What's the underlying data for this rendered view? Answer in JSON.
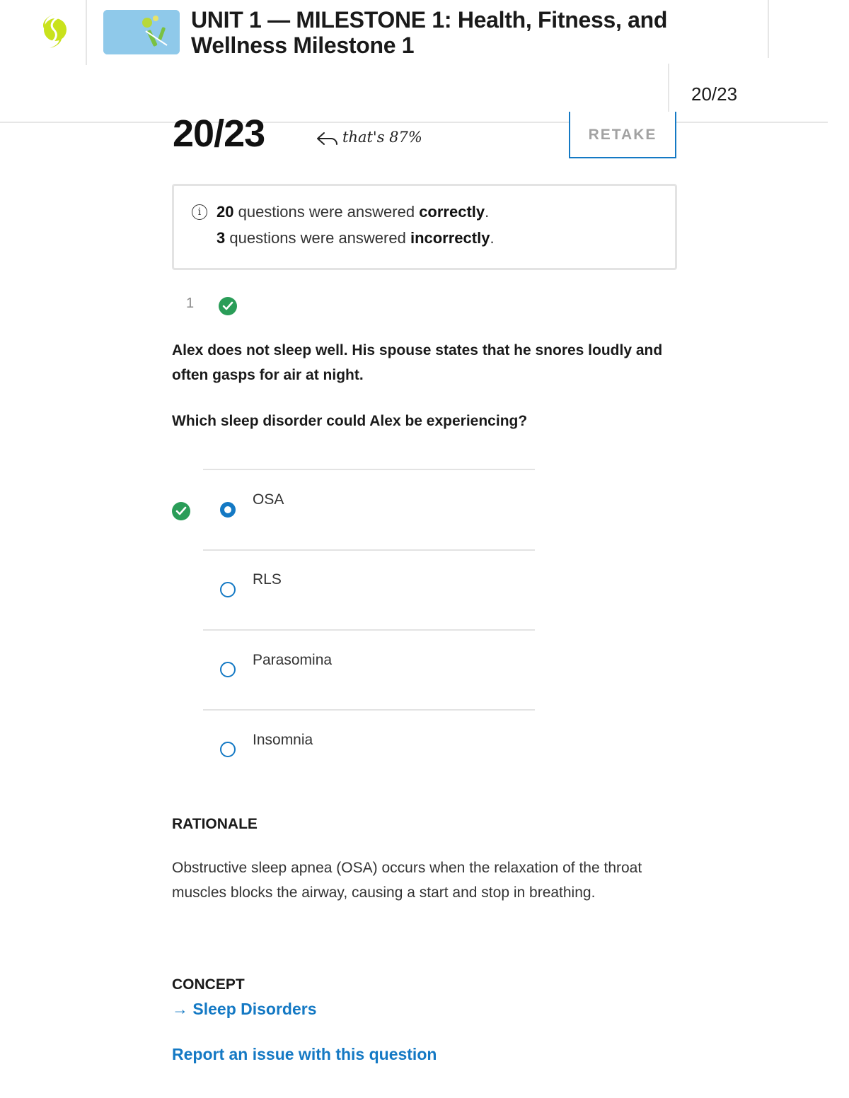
{
  "header": {
    "title": "UNIT 1 — MILESTONE 1: Health, Fitness, and Wellness Milestone 1",
    "score": "20/23"
  },
  "result": {
    "score": "20/23",
    "percent_note": "that's 87%",
    "retake_label": "RETAKE"
  },
  "summary": {
    "correct_count": "20",
    "correct_text": " questions were answered ",
    "correct_word": "correctly",
    "incorrect_count": "3",
    "incorrect_text": " questions were answered ",
    "incorrect_word": "incorrectly",
    "period": "."
  },
  "question": {
    "number": "1",
    "status": "correct",
    "stem": "Alex does not sleep well. His spouse states that he snores loudly and often gasps for air at night.",
    "prompt": "Which sleep disorder could Alex be experiencing?",
    "options": [
      {
        "label": "OSA",
        "selected": true,
        "correct": true
      },
      {
        "label": "RLS",
        "selected": false,
        "correct": false
      },
      {
        "label": "Parasomina",
        "selected": false,
        "correct": false
      },
      {
        "label": "Insomnia",
        "selected": false,
        "correct": false
      }
    ]
  },
  "rationale": {
    "heading": "RATIONALE",
    "text": "Obstructive sleep apnea (OSA) occurs when the relaxation of the throat muscles blocks the airway, causing a start and stop in breathing."
  },
  "concept": {
    "heading": "CONCEPT",
    "arrow": "→",
    "link": "Sleep Disorders"
  },
  "report_link": "Report an issue with this question",
  "colors": {
    "accent": "#1479c4",
    "correct": "#2a9d58",
    "logo": "#c9e21c"
  }
}
